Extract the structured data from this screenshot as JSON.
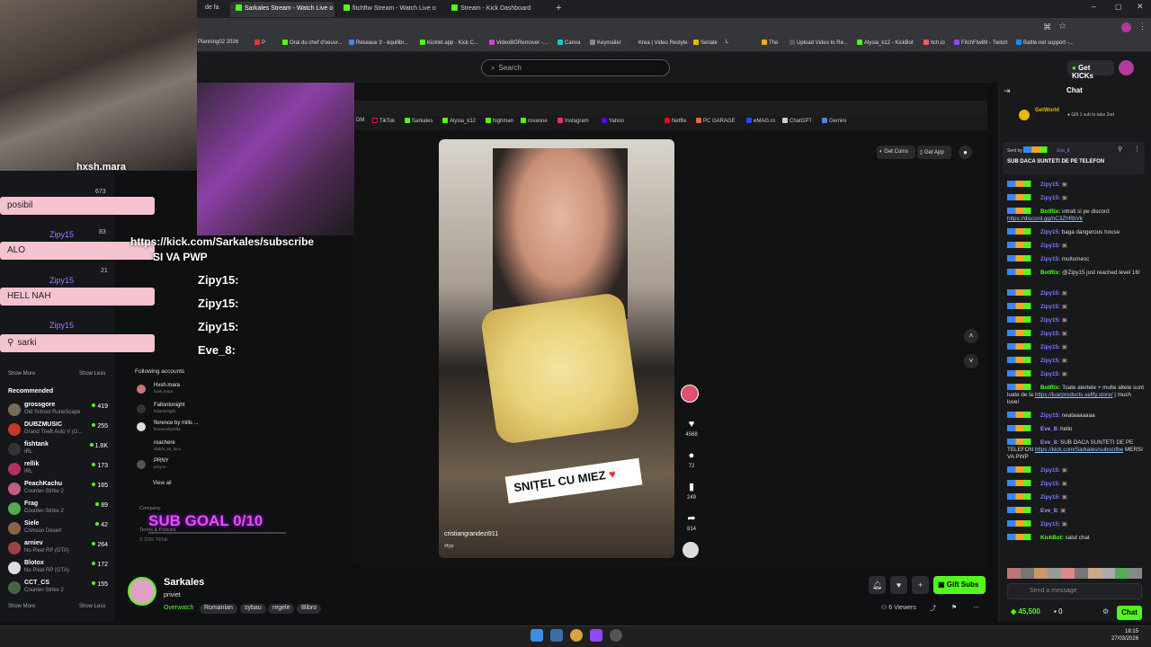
{
  "browser": {
    "tabs": [
      {
        "label": "de fa"
      },
      {
        "label": "Sarkales Stream - Watch Live o"
      },
      {
        "label": "fitchftw Stream - Watch Live o"
      },
      {
        "label": "Stream - Kick Dashboard"
      }
    ],
    "bookmarks": [
      "Planning02 2026",
      "P",
      "Oral du chef d'oeuvr...",
      "Réseaux 3 - équilibr...",
      "Kicklet.app - Kick C...",
      "VideoBGRemover -...",
      "Canva",
      "Keymailer",
      "Krea | Video Restyle",
      "Seriale",
      "L",
      "The",
      "Upload Video to Re...",
      "Alysia_k12 - KickBot",
      "itch.io",
      "FitchFtw89 - Twitch",
      "Battle.net support -..."
    ]
  },
  "kick": {
    "search_placeholder": "Search",
    "get_kicks": "Get KICKs",
    "sidebar": {
      "show_more": "Show More",
      "show_less": "Show Less",
      "recommended_title": "Recommended",
      "recommended": [
        {
          "name": "grossgore",
          "game": "Old School RuneScape",
          "viewers": "419"
        },
        {
          "name": "DUBZMUSIC",
          "game": "Grand Theft Auto V (G...",
          "viewers": "255"
        },
        {
          "name": "fishtank",
          "game": "IRL",
          "viewers": "1.8K"
        },
        {
          "name": "rellik",
          "game": "IRL",
          "viewers": "173"
        },
        {
          "name": "PeachKachu",
          "game": "Counter-Strike 2",
          "viewers": "165"
        },
        {
          "name": "Frag",
          "game": "Counter-Strike 2",
          "viewers": "89"
        },
        {
          "name": "Sieſe",
          "game": "Crimson Desert",
          "viewers": "42"
        },
        {
          "name": "arniev",
          "game": "No Pixel RP (GTA)",
          "viewers": "264"
        },
        {
          "name": "Blotox",
          "game": "No Pixel RP (GTA)",
          "viewers": "172"
        },
        {
          "name": "CCT_CS",
          "game": "Counter-Strike 2",
          "viewers": "155"
        }
      ],
      "show_more_2": "Show More",
      "show_less_2": "Show Less"
    },
    "channel": {
      "name": "Sarkales",
      "title": "priviet",
      "category": "Overwatch",
      "tags": [
        "Romanian",
        "sybau",
        "regele",
        "8libro"
      ],
      "viewers": "6 Viewers",
      "gift_subs": "Gift Subs"
    },
    "chat": {
      "title": "Chat",
      "top_user": "GetWorld",
      "top_note": "Gift 1 sub to take 2nd",
      "pinned_sender": "Sent by",
      "pinned_user": "Eve_8",
      "pinned_text": "SUB DACA SUNTETI DE PE TELEFON",
      "messages": [
        {
          "user": "Zipy15",
          "text": ""
        },
        {
          "user": "Zipy15",
          "text": ""
        },
        {
          "user": "BotRix",
          "text": "intrati si pe discord",
          "link": "https://discord.gg/nC3ZhRbVk"
        },
        {
          "user": "Zipy15",
          "text": "baga dangerous house"
        },
        {
          "user": "Zipy15",
          "text": ""
        },
        {
          "user": "Zipy15",
          "text": "multumesc"
        },
        {
          "user": "BotRix",
          "text": "@Zipy15 just reached level 16!"
        },
        {
          "user": "Zipy15",
          "text": ""
        },
        {
          "user": "Zipy15",
          "text": ""
        },
        {
          "user": "Zipy15",
          "text": ""
        },
        {
          "user": "Zipy15",
          "text": ""
        },
        {
          "user": "Zipy15",
          "text": ""
        },
        {
          "user": "Zipy15",
          "text": ""
        },
        {
          "user": "Zipy15",
          "text": ""
        },
        {
          "user": "BotRix",
          "text": "Toate alertele + multe altele sunt luate de la",
          "link": "https://luarproducts.sellfy.store/",
          "text2": "| much love!"
        },
        {
          "user": "Zipy15",
          "text": "neataaaaaaa"
        },
        {
          "user": "Eve_8",
          "text": "hello"
        },
        {
          "user": "Eve_8",
          "text": "SUB DACA SUNTETI DE PE TELEFON",
          "link": "https://kick.com/Sarkales/subscribe",
          "text2": "MERSI VA PWP"
        },
        {
          "user": "Zipy15",
          "text": ""
        },
        {
          "user": "Zipy15",
          "text": ""
        },
        {
          "user": "Zipy15",
          "text": ""
        },
        {
          "user": "Eve_8",
          "text": ""
        },
        {
          "user": "Zipy15",
          "text": ""
        },
        {
          "user": "KickBot",
          "text": "salut chat"
        }
      ],
      "input_placeholder": "Send a message",
      "kicks_balance": "45,500",
      "count": "0",
      "chat_button": "Chat"
    }
  },
  "overlay": {
    "streamer_tag": "hxsh.mara",
    "lines": [
      "posibil",
      "ALO",
      "HELL NAH",
      "sarki"
    ],
    "user": "Zipy15",
    "subscribe_link": "https://kick.com/Sarkales/subscribe",
    "subscribe_text": "SI VA PWP",
    "big_chat": [
      {
        "user": "Zipy15:"
      },
      {
        "user": "Zipy15:"
      },
      {
        "user": "Zipy15:"
      },
      {
        "user": "Eve_8:"
      }
    ],
    "sub_goal": "SUB GOAL 0/10",
    "numbers": [
      "673",
      "83",
      "21"
    ]
  },
  "tiktok": {
    "get_coins": "Get Coins",
    "get_app": "Get App",
    "bookmarks": [
      "DM",
      "TikTok",
      "Sarkales",
      "Alysia_k12",
      "highman",
      "roxanne",
      "Instagram",
      "Yahoo",
      "Netflix",
      "PC GARAGE",
      "eMAG.ro",
      "ChatGPT",
      "Gemini"
    ],
    "following_title": "Following accounts",
    "following": [
      {
        "name": "Hxsh.mara",
        "handle": "hxsh.mara"
      },
      {
        "name": "Fallontonight",
        "handle": "fallontonight"
      },
      {
        "name": "florence by mills ...",
        "handle": "florencebymills"
      },
      {
        "name": "roachere",
        "handle": "diablo_es_loco"
      },
      {
        "name": "PRNY",
        "handle": "prny.ro"
      }
    ],
    "view_all": "View all",
    "company": "Company",
    "terms": "Terms & Policies",
    "copyright": "© 2026 TikTok",
    "caption": "SNIȚEL CU MIEZ",
    "creator": "cristiangrandezi911",
    "hashtag": "#fyp",
    "actions": [
      {
        "label": "4568"
      },
      {
        "label": "72"
      },
      {
        "label": "249"
      },
      {
        "label": "814"
      }
    ]
  },
  "taskbar": {
    "time": "18:15",
    "date": "27/03/2026"
  }
}
